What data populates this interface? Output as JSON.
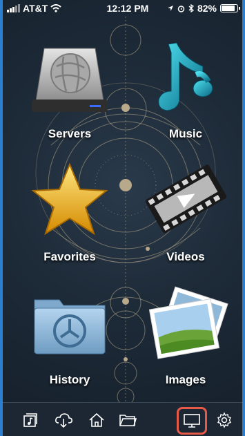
{
  "status_bar": {
    "carrier": "AT&T",
    "time": "12:12 PM",
    "battery": "82%"
  },
  "tiles": [
    {
      "id": "servers",
      "label": "Servers"
    },
    {
      "id": "music",
      "label": "Music"
    },
    {
      "id": "favorites",
      "label": "Favorites"
    },
    {
      "id": "videos",
      "label": "Videos"
    },
    {
      "id": "history",
      "label": "History"
    },
    {
      "id": "images",
      "label": "Images"
    }
  ],
  "tab_bar": {
    "items": [
      {
        "icon": "music-library-icon"
      },
      {
        "icon": "cloud-download-icon"
      },
      {
        "icon": "home-icon"
      },
      {
        "icon": "folder-icon"
      },
      {
        "icon": "tv-screen-icon",
        "selected": true
      },
      {
        "icon": "gear-icon"
      }
    ]
  },
  "colors": {
    "background": "#1a2532",
    "frame": "#2b7fd0",
    "highlight": "#e85a48",
    "label": "#ffffff"
  }
}
